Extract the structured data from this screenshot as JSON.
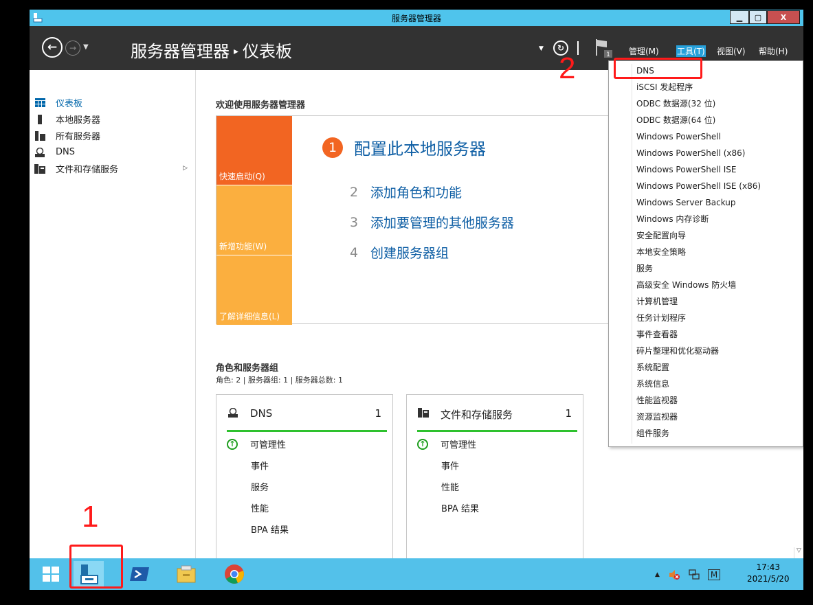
{
  "window": {
    "title": "服务器管理器",
    "min_label": "▁",
    "max_label": "▢",
    "close_label": "X"
  },
  "header": {
    "breadcrumb_root": "服务器管理器",
    "breadcrumb_sep": "▸",
    "breadcrumb_page": "仪表板",
    "notification_count": "1",
    "menus": {
      "manage": "管理(M)",
      "tools": "工具(T)",
      "view": "视图(V)",
      "help": "帮助(H)"
    }
  },
  "sidebar": {
    "items": [
      {
        "label": "仪表板",
        "icon": "dashboard-icon"
      },
      {
        "label": "本地服务器",
        "icon": "server-icon"
      },
      {
        "label": "所有服务器",
        "icon": "servers-icon"
      },
      {
        "label": "DNS",
        "icon": "dns-icon"
      },
      {
        "label": "文件和存储服务",
        "icon": "storage-icon"
      }
    ]
  },
  "welcome": {
    "title": "欢迎使用服务器管理器",
    "tiles": {
      "quick_start": "快速启动(Q)",
      "whats_new": "新增功能(W)",
      "learn_more": "了解详细信息(L)"
    },
    "steps": [
      {
        "num": "1",
        "label": "配置此本地服务器"
      },
      {
        "num": "2",
        "label": "添加角色和功能"
      },
      {
        "num": "3",
        "label": "添加要管理的其他服务器"
      },
      {
        "num": "4",
        "label": "创建服务器组"
      }
    ]
  },
  "roles": {
    "title": "角色和服务器组",
    "summary": "角色: 2 | 服务器组: 1 | 服务器总数: 1",
    "cards": [
      {
        "name": "DNS",
        "count": "1",
        "rows": [
          "可管理性",
          "事件",
          "服务",
          "性能",
          "BPA 结果"
        ]
      },
      {
        "name": "文件和存储服务",
        "count": "1",
        "rows": [
          "可管理性",
          "事件",
          "性能",
          "BPA 结果"
        ]
      }
    ]
  },
  "tools_menu": {
    "items": [
      "DNS",
      "iSCSI 发起程序",
      "ODBC 数据源(32 位)",
      "ODBC 数据源(64 位)",
      "Windows PowerShell",
      "Windows PowerShell (x86)",
      "Windows PowerShell ISE",
      "Windows PowerShell ISE (x86)",
      "Windows Server Backup",
      "Windows 内存诊断",
      "安全配置向导",
      "本地安全策略",
      "服务",
      "高级安全 Windows 防火墙",
      "计算机管理",
      "任务计划程序",
      "事件查看器",
      "碎片整理和优化驱动器",
      "系统配置",
      "系统信息",
      "性能监视器",
      "资源监视器",
      "组件服务"
    ]
  },
  "taskbar": {
    "tray_ime": "M",
    "time": "17:43",
    "date": "2021/5/20"
  },
  "annotations": {
    "step1": "1",
    "step2": "2"
  },
  "colors": {
    "titlebar": "#4fc4ec",
    "header": "#323232",
    "quick_tile": "#f26522",
    "secondary_tile": "#fbaf3f",
    "link_blue": "#0f5fa5",
    "status_green": "#2ec12e",
    "annotation_red": "#ff1a1a"
  }
}
